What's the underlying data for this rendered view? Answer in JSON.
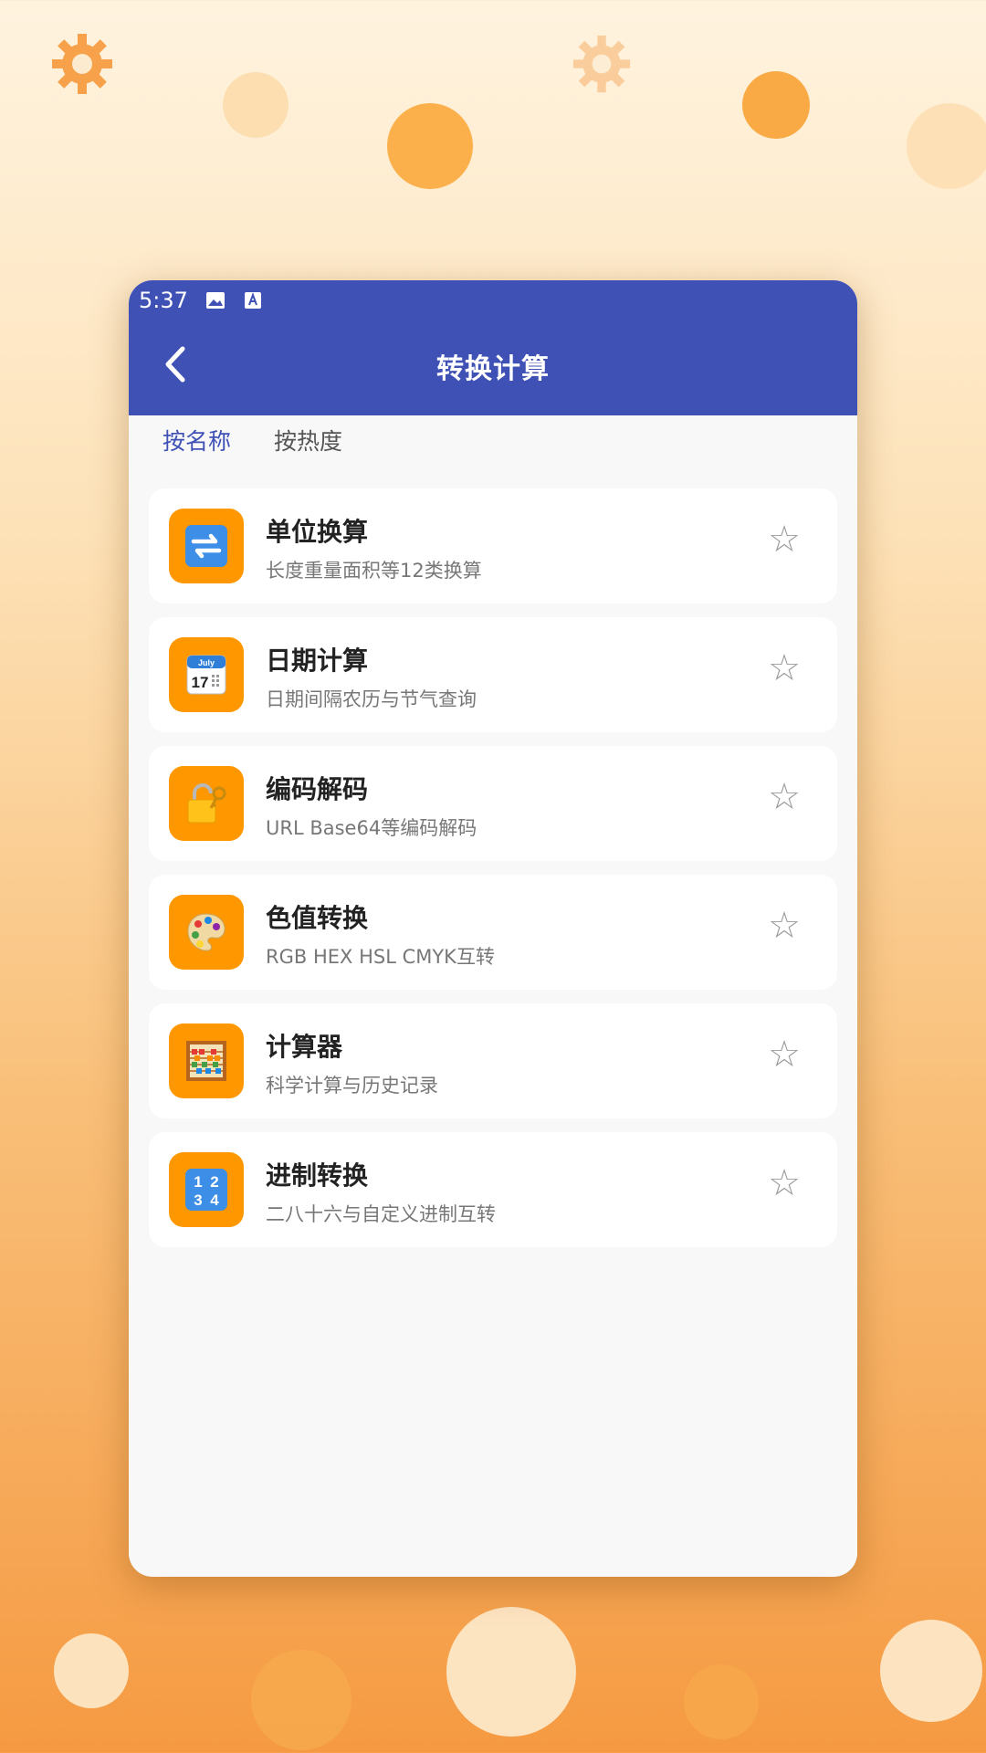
{
  "status_bar": {
    "time": "5:37"
  },
  "header": {
    "title": "转换计算"
  },
  "tabs": [
    {
      "label": "按名称",
      "active": true
    },
    {
      "label": "按热度",
      "active": false
    }
  ],
  "items": [
    {
      "title": "单位换算",
      "subtitle": "长度重量面积等12类换算",
      "icon": "refresh-arrows-icon"
    },
    {
      "title": "日期计算",
      "subtitle": "日期间隔农历与节气查询",
      "icon": "calendar-icon",
      "calendar_month": "July",
      "calendar_day": "17"
    },
    {
      "title": "编码解码",
      "subtitle": "URL Base64等编码解码",
      "icon": "lock-key-icon"
    },
    {
      "title": "色值转换",
      "subtitle": "RGB HEX HSL CMYK互转",
      "icon": "palette-icon"
    },
    {
      "title": "计算器",
      "subtitle": "科学计算与历史记录",
      "icon": "abacus-icon"
    },
    {
      "title": "进制转换",
      "subtitle": "二八十六与自定义进制互转",
      "icon": "numbers-icon",
      "digits": [
        "1",
        "2",
        "3",
        "4"
      ]
    }
  ],
  "favorite_symbol": "☆",
  "colors": {
    "primary": "#3f51b5",
    "icon_bg": "#ff9800"
  }
}
